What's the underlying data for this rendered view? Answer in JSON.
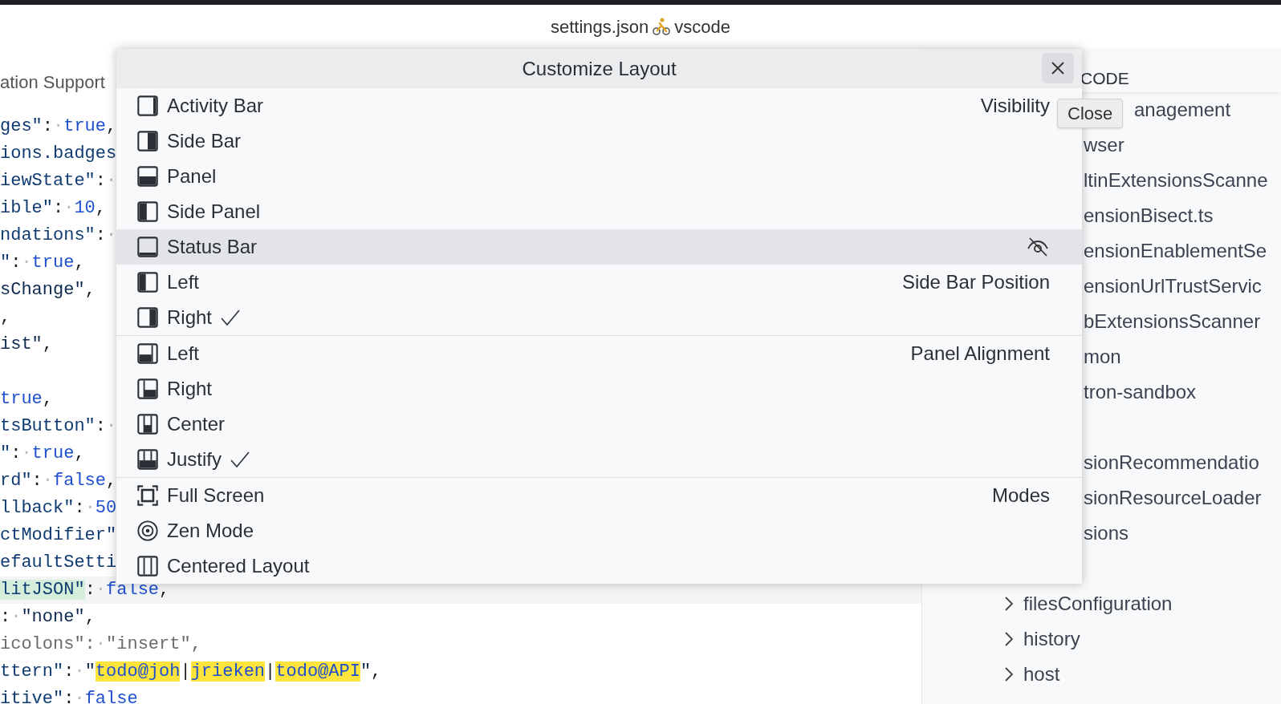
{
  "window": {
    "title": "settings.json",
    "workspace": "vscode"
  },
  "editor": {
    "tab": "ation Support",
    "lines": [
      {
        "current": false,
        "tokens": [
          {
            "kind": "key",
            "text": "ges\""
          },
          {
            "kind": "punct",
            "text": ":"
          },
          {
            "kind": "ws",
            "text": "·"
          },
          {
            "kind": "literal",
            "text": "true"
          },
          {
            "kind": "punct",
            "text": ","
          }
        ]
      },
      {
        "current": false,
        "tokens": [
          {
            "kind": "key",
            "text": "ions.badges"
          }
        ]
      },
      {
        "current": false,
        "tokens": [
          {
            "kind": "key",
            "text": "iewState\""
          },
          {
            "kind": "punct",
            "text": ":"
          },
          {
            "kind": "ws",
            "text": "·"
          }
        ]
      },
      {
        "current": false,
        "tokens": [
          {
            "kind": "key",
            "text": "ible\""
          },
          {
            "kind": "punct",
            "text": ":"
          },
          {
            "kind": "ws",
            "text": "·"
          },
          {
            "kind": "literal",
            "text": "10"
          },
          {
            "kind": "punct",
            "text": ","
          }
        ]
      },
      {
        "current": false,
        "tokens": [
          {
            "kind": "key",
            "text": "ndations\""
          },
          {
            "kind": "punct",
            "text": ":"
          },
          {
            "kind": "ws",
            "text": "·"
          }
        ]
      },
      {
        "current": false,
        "tokens": [
          {
            "kind": "key",
            "text": "\""
          },
          {
            "kind": "punct",
            "text": ":"
          },
          {
            "kind": "ws",
            "text": "·"
          },
          {
            "kind": "literal",
            "text": "true"
          },
          {
            "kind": "punct",
            "text": ","
          }
        ]
      },
      {
        "current": false,
        "tokens": [
          {
            "kind": "string",
            "text": "sChange\""
          },
          {
            "kind": "punct",
            "text": ","
          }
        ]
      },
      {
        "current": false,
        "tokens": [
          {
            "kind": "punct",
            "text": ","
          }
        ]
      },
      {
        "current": false,
        "tokens": [
          {
            "kind": "string",
            "text": "ist\""
          },
          {
            "kind": "punct",
            "text": ","
          }
        ]
      },
      {
        "current": false
      },
      {
        "current": false,
        "tokens": [
          {
            "kind": "literal",
            "text": "true"
          },
          {
            "kind": "punct",
            "text": ","
          }
        ]
      },
      {
        "current": false,
        "tokens": [
          {
            "kind": "key",
            "text": "tsButton\""
          },
          {
            "kind": "punct",
            "text": ":"
          },
          {
            "kind": "ws",
            "text": "·"
          }
        ]
      },
      {
        "current": false,
        "tokens": [
          {
            "kind": "key",
            "text": "\""
          },
          {
            "kind": "punct",
            "text": ":"
          },
          {
            "kind": "ws",
            "text": "·"
          },
          {
            "kind": "literal",
            "text": "true"
          },
          {
            "kind": "punct",
            "text": ","
          }
        ]
      },
      {
        "current": false,
        "tokens": [
          {
            "kind": "key",
            "text": "rd\""
          },
          {
            "kind": "punct",
            "text": ":"
          },
          {
            "kind": "ws",
            "text": "·"
          },
          {
            "kind": "literal",
            "text": "false"
          },
          {
            "kind": "punct",
            "text": ","
          }
        ]
      },
      {
        "current": false,
        "tokens": [
          {
            "kind": "key",
            "text": "llback\""
          },
          {
            "kind": "punct",
            "text": ":"
          },
          {
            "kind": "ws",
            "text": "·"
          },
          {
            "kind": "literal",
            "text": "50"
          }
        ]
      },
      {
        "current": false,
        "tokens": [
          {
            "kind": "key",
            "text": "ctModifier\""
          }
        ]
      },
      {
        "current": false,
        "tokens": [
          {
            "kind": "key",
            "text": "efaultSetti"
          }
        ]
      },
      {
        "current": true,
        "tokens": [
          {
            "kind": "match",
            "text": "litJSON\""
          },
          {
            "kind": "punct",
            "text": ":"
          },
          {
            "kind": "ws",
            "text": "·"
          },
          {
            "kind": "literal",
            "text": "false"
          },
          {
            "kind": "punct",
            "text": ","
          }
        ]
      },
      {
        "current": false,
        "tokens": [
          {
            "kind": "punct",
            "text": ":"
          },
          {
            "kind": "ws",
            "text": "·"
          },
          {
            "kind": "string",
            "text": "\"none\""
          },
          {
            "kind": "punct",
            "text": ","
          }
        ]
      },
      {
        "current": false,
        "tokens": [
          {
            "kind": "dim",
            "text": "icolons\":"
          },
          {
            "kind": "ws",
            "text": "·"
          },
          {
            "kind": "dim",
            "text": "\"insert\","
          }
        ]
      },
      {
        "current": false,
        "tokens": [
          {
            "kind": "key",
            "text": "ttern\""
          },
          {
            "kind": "punct",
            "text": ":"
          },
          {
            "kind": "ws",
            "text": "·"
          },
          {
            "kind": "string",
            "text": "\""
          },
          {
            "kind": "find",
            "text": "todo@joh"
          },
          {
            "kind": "punct",
            "text": "|"
          },
          {
            "kind": "find",
            "text": "jrieken"
          },
          {
            "kind": "punct",
            "text": "|"
          },
          {
            "kind": "find",
            "text": "todo@API"
          },
          {
            "kind": "string",
            "text": "\""
          },
          {
            "kind": "punct",
            "text": ","
          }
        ]
      },
      {
        "current": false,
        "tokens": [
          {
            "kind": "key",
            "text": "itive\""
          },
          {
            "kind": "punct",
            "text": ":"
          },
          {
            "kind": "ws",
            "text": "·"
          },
          {
            "kind": "literal",
            "text": "false"
          }
        ]
      }
    ]
  },
  "sidebar": {
    "header": "CODE",
    "items": [
      {
        "label": "anagement",
        "kind": "file"
      },
      {
        "label": "wser",
        "kind": "file"
      },
      {
        "label": "ltinExtensionsScanne",
        "kind": "file"
      },
      {
        "label": "ensionBisect.ts",
        "kind": "file"
      },
      {
        "label": "ensionEnablementSe",
        "kind": "file"
      },
      {
        "label": "ensionUrlTrustServic",
        "kind": "file"
      },
      {
        "label": "bExtensionsScanner",
        "kind": "file"
      },
      {
        "label": "mon",
        "kind": "file"
      },
      {
        "label": "tron-sandbox",
        "kind": "file"
      },
      {
        "kind": "blank"
      },
      {
        "label": "sionRecommendatio",
        "kind": "file"
      },
      {
        "label": "sionResourceLoader",
        "kind": "file"
      },
      {
        "label": "sions",
        "kind": "file"
      },
      {
        "kind": "blank"
      },
      {
        "label": "filesConfiguration",
        "kind": "folder",
        "expanded": false
      },
      {
        "label": "history",
        "kind": "folder",
        "expanded": false
      },
      {
        "label": "host",
        "kind": "folder",
        "expanded": false
      }
    ]
  },
  "dialog": {
    "title": "Customize Layout",
    "close_tooltip": "Close",
    "sections": [
      {
        "label": "Visibility",
        "divider": false,
        "items": [
          {
            "label": "Activity Bar",
            "kind": "activity-bar",
            "selected": false
          },
          {
            "label": "Side Bar",
            "kind": "side-bar",
            "selected": false
          },
          {
            "label": "Panel",
            "kind": "panel",
            "selected": false
          },
          {
            "label": "Side Panel",
            "kind": "side-panel",
            "selected": false
          },
          {
            "label": "Status Bar",
            "kind": "status-bar",
            "selected": true
          }
        ]
      },
      {
        "label": "Side Bar Position",
        "divider": false,
        "items": [
          {
            "label": "Left",
            "kind": "side-left",
            "selected": false,
            "checked": false
          },
          {
            "label": "Right",
            "kind": "side-right",
            "selected": false,
            "checked": true
          }
        ]
      },
      {
        "label": "Panel Alignment",
        "divider": true,
        "items": [
          {
            "label": "Left",
            "kind": "panel-left",
            "selected": false,
            "checked": false
          },
          {
            "label": "Right",
            "kind": "panel-right",
            "selected": false,
            "checked": false
          },
          {
            "label": "Center",
            "kind": "panel-center",
            "selected": false,
            "checked": false
          },
          {
            "label": "Justify",
            "kind": "panel-justify",
            "selected": false,
            "checked": true
          }
        ]
      },
      {
        "label": "Modes",
        "divider": true,
        "items": [
          {
            "label": "Full Screen",
            "kind": "fullscreen",
            "selected": false
          },
          {
            "label": "Zen Mode",
            "kind": "zen",
            "selected": false
          },
          {
            "label": "Centered Layout",
            "kind": "centered",
            "selected": false
          }
        ]
      }
    ]
  }
}
